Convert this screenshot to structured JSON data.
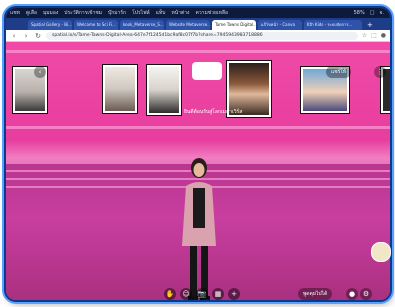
{
  "menubar": {
    "items": [
      "แชท",
      "ดูเลือ",
      "มุมมอง",
      "ประวัติการเข้าชม",
      "บุ๊กมาร์ก",
      "โปรไฟล์",
      "แท็บ",
      "หน้าต่าง",
      "ความช่วยเหลือ"
    ],
    "status": [
      "58%",
      "□",
      "จ."
    ]
  },
  "tabs": [
    {
      "label": "Spatial Gallery - Bi..."
    },
    {
      "label": "Welcome to Sci Fi..."
    },
    {
      "label": "kook_Metaverse_S..."
    },
    {
      "label": "Website Metaverse..."
    },
    {
      "label": "Tame Tawns Digital..."
    },
    {
      "label": "แก้ไขหน้า - Canva"
    },
    {
      "label": "Kth Kids - ระบบจัดการ..."
    }
  ],
  "address": {
    "url": "spatial.io/s/Tame-Tawns-Digital-Area-647e7f1245d1bc9af8c07f7b?share=7945943983718886"
  },
  "scene": {
    "sign_text": "ยินดีต้อนรับสู่โลกเมตาเวิร์ส",
    "top_left_button": "‹",
    "top_right_pill": "แชร์ให้",
    "top_right_more": "⋮",
    "bottom_right_pill": "พูดคุยไปได้"
  },
  "toolbar": {
    "buttons": [
      "✋",
      "☺",
      "📷",
      "▦",
      "+"
    ]
  },
  "colors": {
    "wall": "#e83d9e",
    "floor": "#c93ea0",
    "browser_chrome": "#1e3c88"
  }
}
